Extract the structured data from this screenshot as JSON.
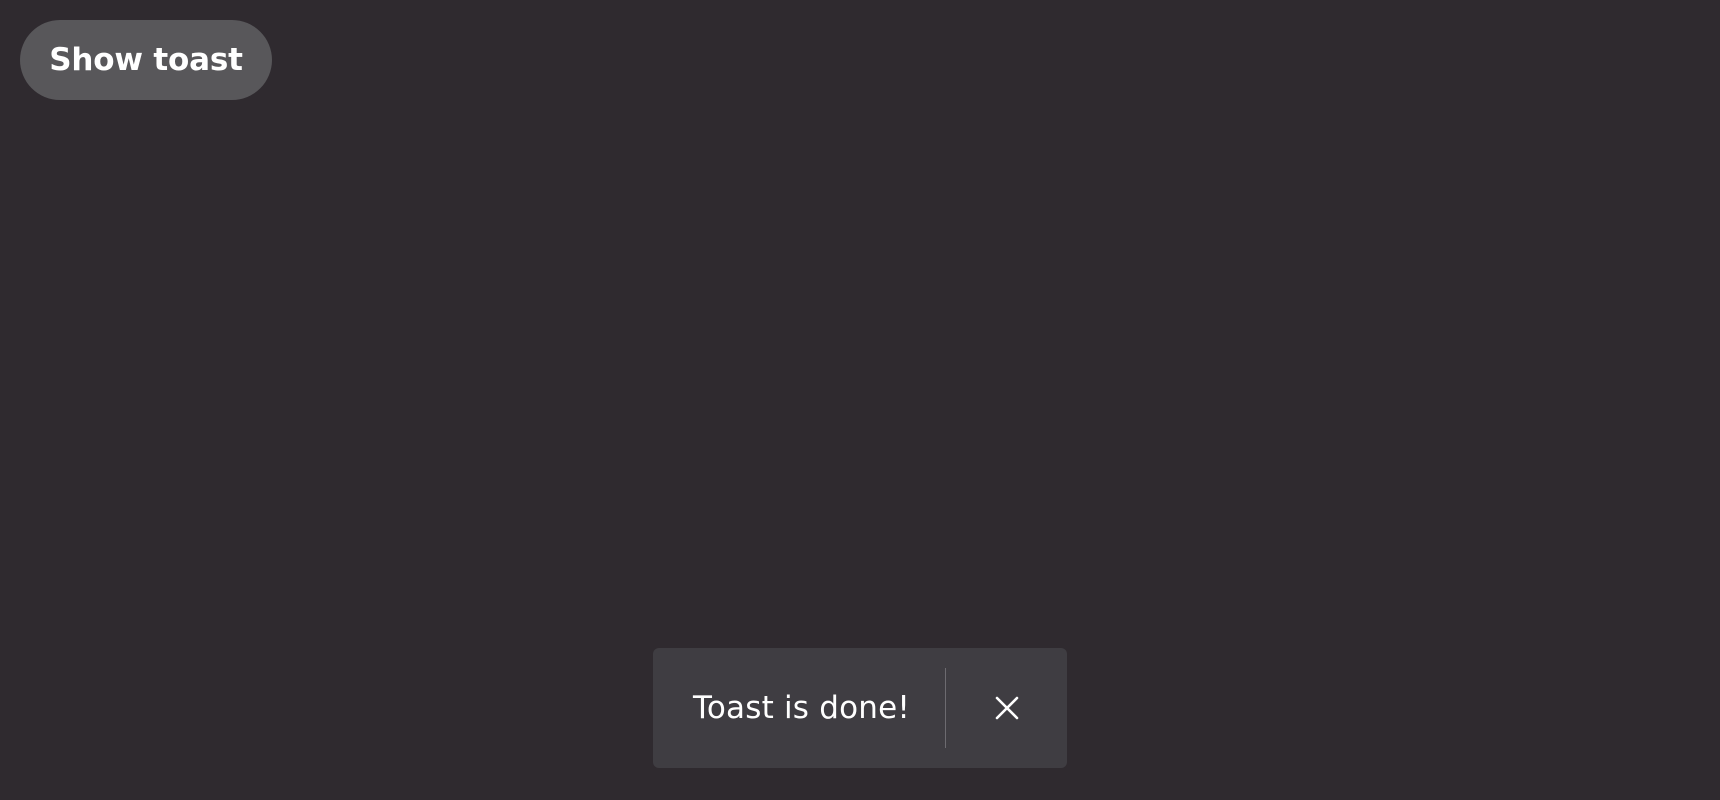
{
  "page": {
    "background_color": "#2f2a2f"
  },
  "controls": {
    "show_toast_label": "Show toast",
    "show_toast_color": "#58575a"
  },
  "toast": {
    "message": "Toast is done!",
    "background_color": "#3f3d42",
    "close_icon": "close-icon"
  }
}
